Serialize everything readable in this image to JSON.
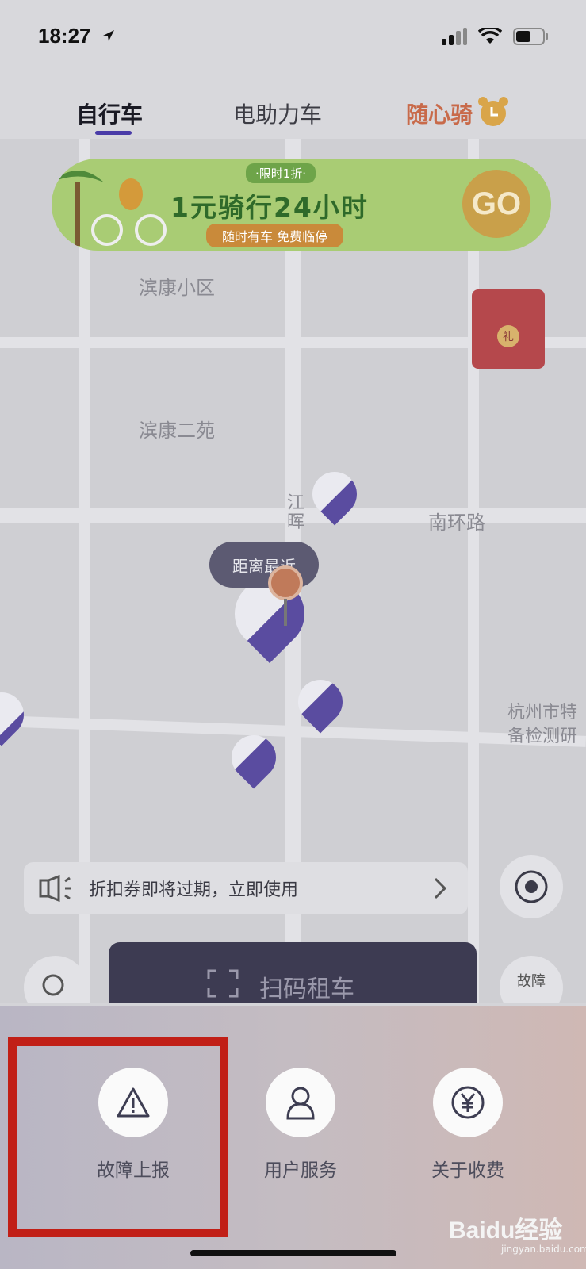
{
  "status_bar": {
    "time": "18:27"
  },
  "tabs": [
    {
      "label": "自行车",
      "active": true
    },
    {
      "label": "电助力车",
      "active": false
    },
    {
      "label": "随心骑",
      "active": false
    }
  ],
  "banner": {
    "tag": "·限时1折·",
    "title": "1元骑行24小时",
    "subtitle": "随时有车 免费临停",
    "go_label": "GO"
  },
  "map": {
    "labels": [
      "滨康小区",
      "滨康二苑",
      "南环路",
      "江晖",
      "杭州市特",
      "备检测研"
    ],
    "nearest_label": "距离最近",
    "redpack_symbol": "礼"
  },
  "coupon": {
    "text": "折扣券即将过期，立即使用"
  },
  "scan_button": {
    "label": "扫码租车"
  },
  "fault_short": "故障",
  "sheet": {
    "actions": [
      {
        "label": "故障上报",
        "icon": "warning-icon"
      },
      {
        "label": "用户服务",
        "icon": "user-icon"
      },
      {
        "label": "关于收费",
        "icon": "yen-icon"
      }
    ]
  },
  "watermark": {
    "main": "Baidu经验",
    "sub": "jingyan.baidu.com"
  },
  "colors": {
    "accent": "#4a3ca8",
    "highlight": "#c11f17",
    "tab_special": "#c86a4a"
  }
}
